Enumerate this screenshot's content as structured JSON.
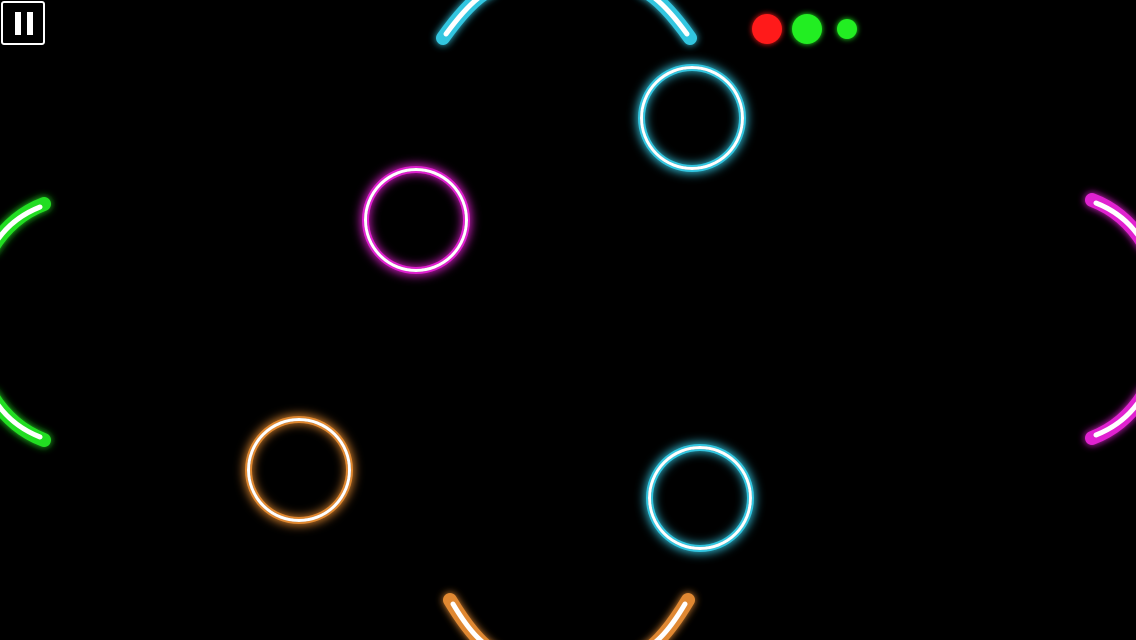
{
  "pause_button": {
    "icon": "pause-icon"
  },
  "lives": [
    {
      "color": "#ff1a1a",
      "state": "lost"
    },
    {
      "color": "#22ee22",
      "state": "remaining"
    },
    {
      "color": "#22ee22",
      "state": "remaining"
    }
  ],
  "paddles": [
    {
      "side": "top",
      "color": "#33c6e0"
    },
    {
      "side": "left",
      "color": "#22dd22"
    },
    {
      "side": "right",
      "color": "#e020d0"
    },
    {
      "side": "bottom",
      "color": "#e08830"
    }
  ],
  "balls": [
    {
      "color": "#33c6e0"
    },
    {
      "color": "#e020d0"
    },
    {
      "color": "#e08830"
    },
    {
      "color": "#33c6e0"
    }
  ]
}
